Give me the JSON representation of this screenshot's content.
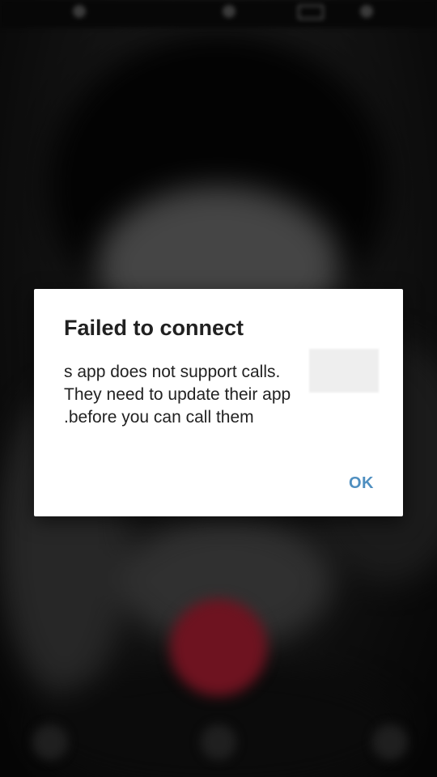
{
  "dialog": {
    "title": "Failed to connect",
    "message_lines": [
      "s app does not support calls.",
      "They need to update their app",
      ".before you can call them"
    ],
    "ok_label": "OK"
  },
  "colors": {
    "accent": "#4f8fc0",
    "dialog_bg": "#ffffff",
    "end_call": "#6e1320"
  },
  "icons": [
    "signal-icon",
    "wifi-icon",
    "battery-icon",
    "clock-icon",
    "end-call-icon"
  ]
}
